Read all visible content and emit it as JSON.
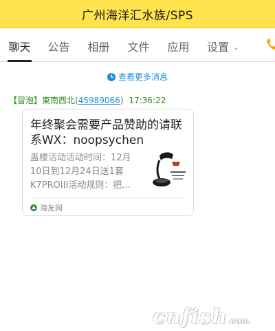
{
  "window": {
    "title": "广州海洋汇水族/SPS"
  },
  "tabs": [
    {
      "label": "聊天",
      "active": true
    },
    {
      "label": "公告"
    },
    {
      "label": "相册"
    },
    {
      "label": "文件"
    },
    {
      "label": "应用"
    },
    {
      "label": "设置",
      "has_dropdown": true
    }
  ],
  "more_messages": {
    "label": "查看更多消息",
    "icon": "clock-icon"
  },
  "message": {
    "tag": "【冒泡】",
    "sender": "東南西北",
    "qq_open": "(",
    "qq": "45989066",
    "qq_close": ")",
    "time": "17:36:22",
    "card": {
      "headline": "年终聚会需要产品赞助的请联系WX：noopsychen",
      "summary": "盖楼活动活动时间：12月\n10日到12月24日送1套\nK7PROIII活动规则：把...",
      "source": "海友网",
      "thumb_icon": "product-lamp-thumbnail"
    }
  },
  "watermark": {
    "text": "cnfish",
    "suffix": ".com"
  },
  "colors": {
    "title_bar": "#ffe44d",
    "accent_green": "#2e8b1e",
    "link_blue": "#1a8cd8",
    "edge_icon": "#f0a000"
  }
}
